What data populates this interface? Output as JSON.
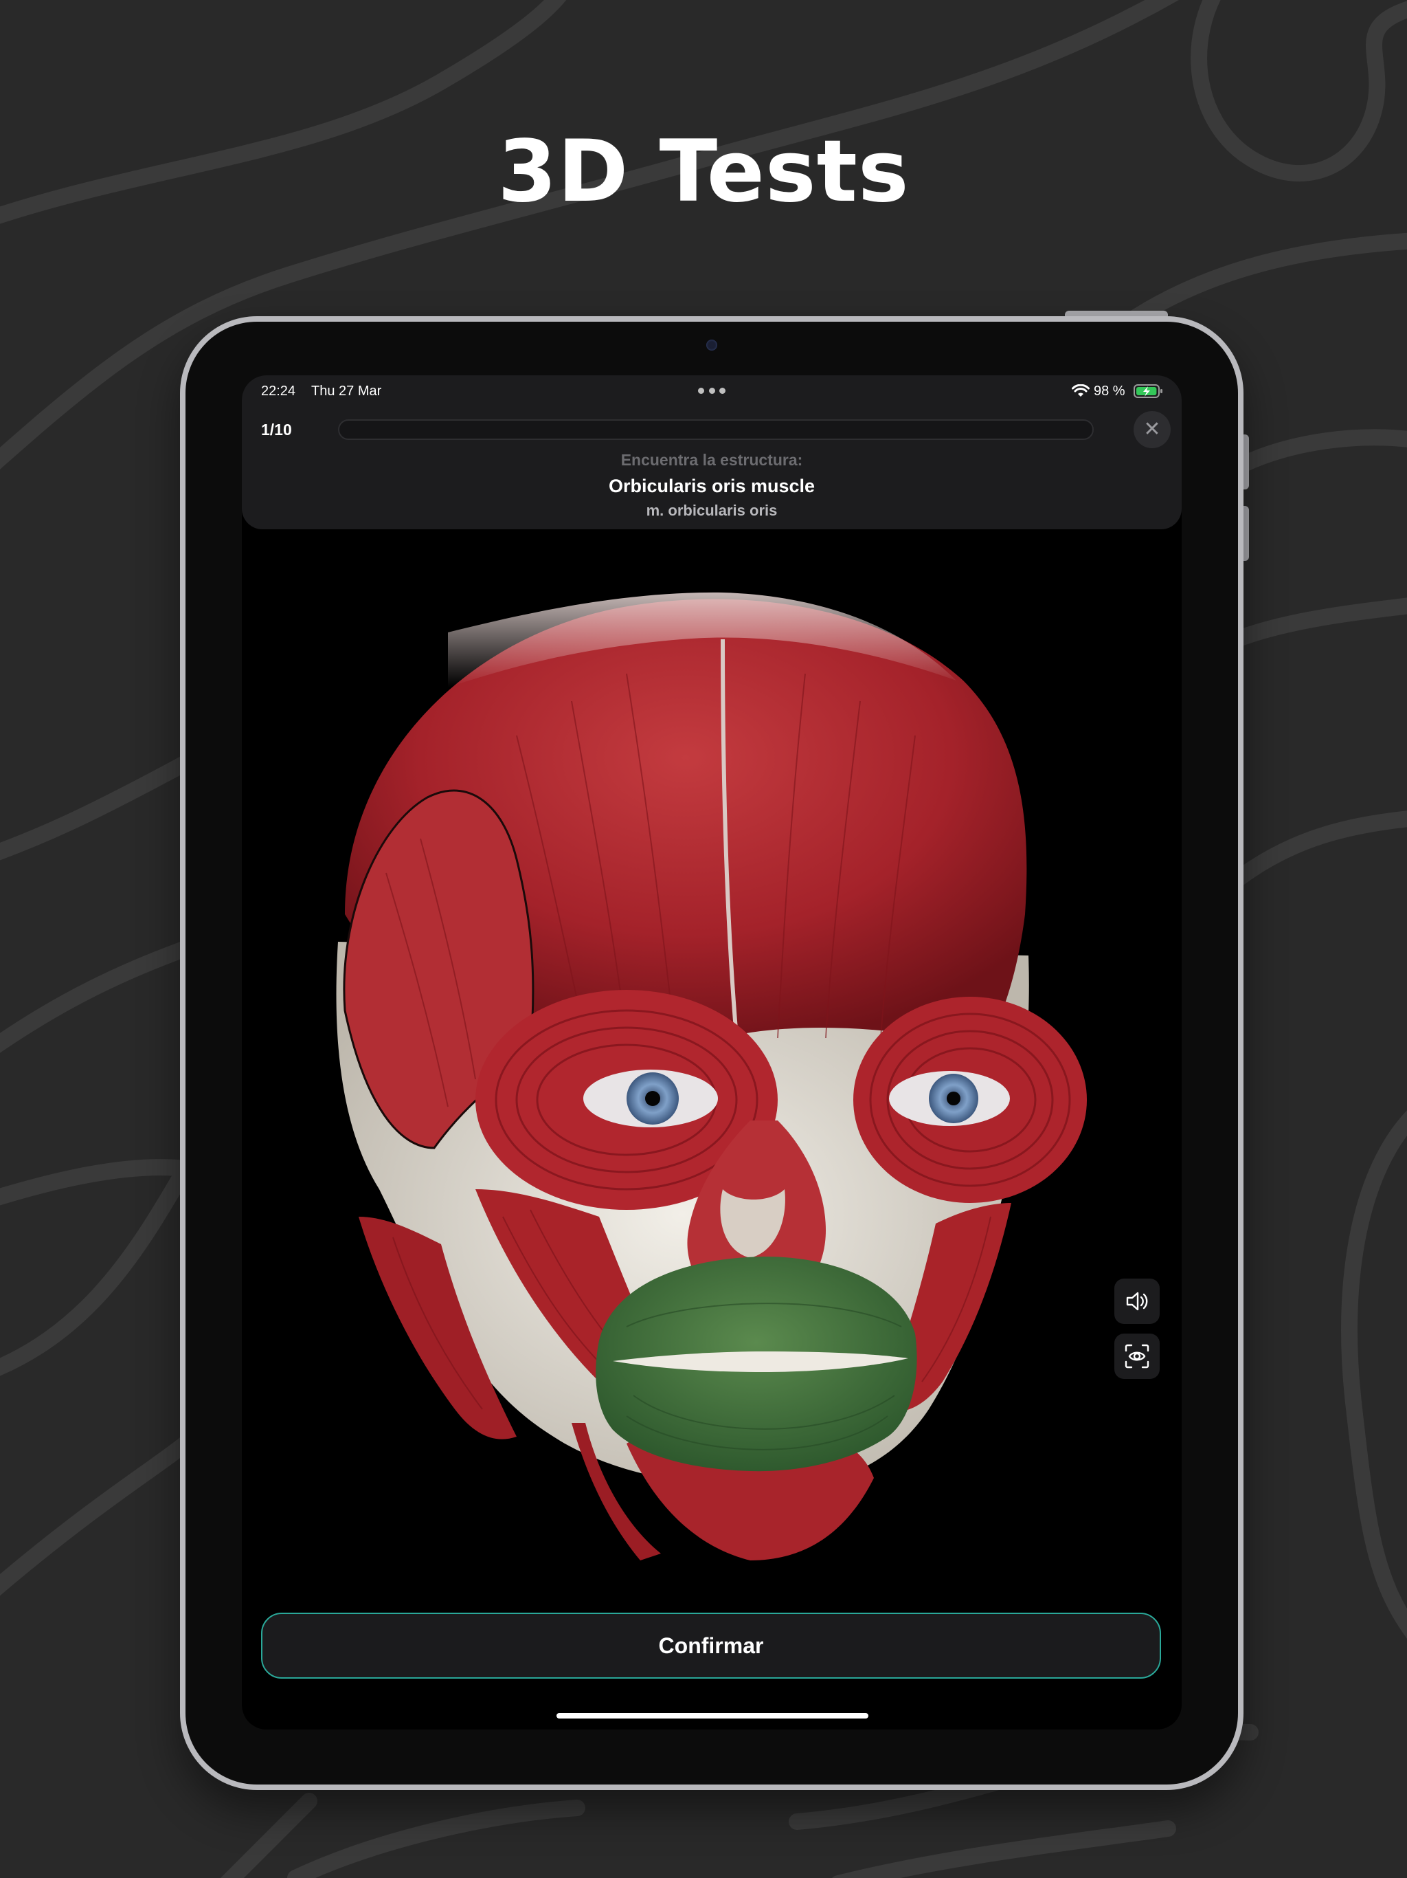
{
  "promo": {
    "title": "3D Tests"
  },
  "status_bar": {
    "time": "22:24",
    "date": "Thu 27 Mar",
    "battery_percent": "98 %",
    "battery_level": 0.98,
    "wifi_icon": "wifi-icon",
    "battery_icon": "battery-charging-icon"
  },
  "quiz": {
    "counter": "1/10",
    "progress": 0.0,
    "close_icon": "close-icon",
    "prompt": "Encuentra la estructura:",
    "structure_name": "Orbicularis oris muscle",
    "structure_latin": "m. orbicularis oris"
  },
  "side_tools": [
    {
      "icon": "speaker-icon"
    },
    {
      "icon": "eye-scan-icon"
    }
  ],
  "model": {
    "subject": "3D facial muscles model",
    "highlighted_color": "#3f6b3a",
    "muscle_color": "#a8232a",
    "bone_color": "#e8e4dc"
  },
  "actions": {
    "confirm_label": "Confirmar"
  },
  "colors": {
    "accent": "#2aa899",
    "background": "#292929",
    "panel": "#1c1c1e"
  }
}
